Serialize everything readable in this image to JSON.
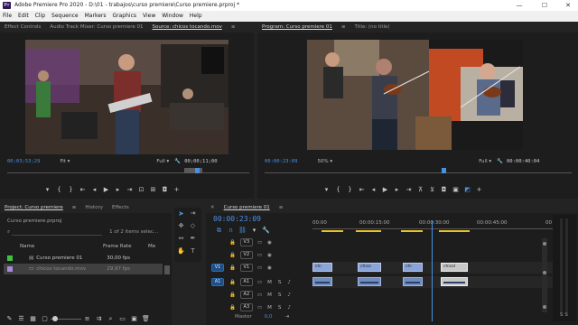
{
  "window": {
    "title": "Adobe Premiere Pro 2020 - D:\\01 - trabajos\\curso premiere\\Curso premiere.prproj *",
    "app_icon": "Pr",
    "minimize": "—",
    "maximize": "☐",
    "close": "✕"
  },
  "menu": [
    "File",
    "Edit",
    "Clip",
    "Sequence",
    "Markers",
    "Graphics",
    "View",
    "Window",
    "Help"
  ],
  "source_panel": {
    "tabs": [
      "Effect Controls",
      "Audio Track Mixer: Curso premiere 01",
      "Source: chicos tocando.mov",
      "≡"
    ],
    "active_tab": "Source: chicos tocando.mov",
    "timecode_current": "00;03;53;29",
    "fit": "Fit",
    "quality": "Full",
    "timecode_duration": "00;00;11;00"
  },
  "program_panel": {
    "tabs": [
      "Program: Curso premiere 01",
      "≡",
      "Title: (no title)"
    ],
    "active_tab": "Program: Curso premiere 01",
    "timecode_current": "00:00:23:09",
    "zoom": "50%",
    "quality": "Full",
    "timecode_duration": "00:00:40:04"
  },
  "project_panel": {
    "tabs": [
      "Project: Curso premiere",
      "≡",
      "History",
      "Effects"
    ],
    "project_file": "Curso premiere.prproj",
    "search_placeholder": "",
    "item_count": "1 of 2 items selec...",
    "columns": {
      "name": "Name",
      "frame_rate": "Frame Rate",
      "media": "Me"
    },
    "items": [
      {
        "name": "Curso premiere 01",
        "frame_rate": "30,00 fps",
        "color": "#3ec33e",
        "selected": false
      },
      {
        "name": "chicos tocando.mov",
        "frame_rate": "29,97 fps",
        "color": "#a68cd6",
        "selected": true
      }
    ]
  },
  "timeline_panel": {
    "tab": "Curso premiere 01",
    "timecode": "00:00:23:09",
    "ruler": [
      "00:00",
      "00:00:15:00",
      "00:00:30:00",
      "00:00:45:00",
      "00"
    ],
    "playhead_pos": 0.495,
    "tracks": {
      "video": [
        {
          "label": "V3",
          "src": ""
        },
        {
          "label": "V2",
          "src": ""
        },
        {
          "label": "V1",
          "src": "V1"
        }
      ],
      "audio": [
        {
          "label": "A1",
          "src": "A1",
          "m": "M",
          "s": "S"
        },
        {
          "label": "A2",
          "src": "",
          "m": "M",
          "s": "S"
        },
        {
          "label": "A3",
          "src": "",
          "m": "M",
          "s": "S"
        }
      ],
      "master_label": "Master",
      "master_value": "0,0"
    },
    "clips_video_labels": [
      "chi",
      "chico",
      "chi",
      "chicol"
    ]
  },
  "colors": {
    "accent_blue": "#4a90e2",
    "panel_bg": "#1d1d1d",
    "clip_video": "#8aa4d8",
    "clip_audio": "#6f8cbf",
    "yellow_bar": "#e6c229"
  }
}
